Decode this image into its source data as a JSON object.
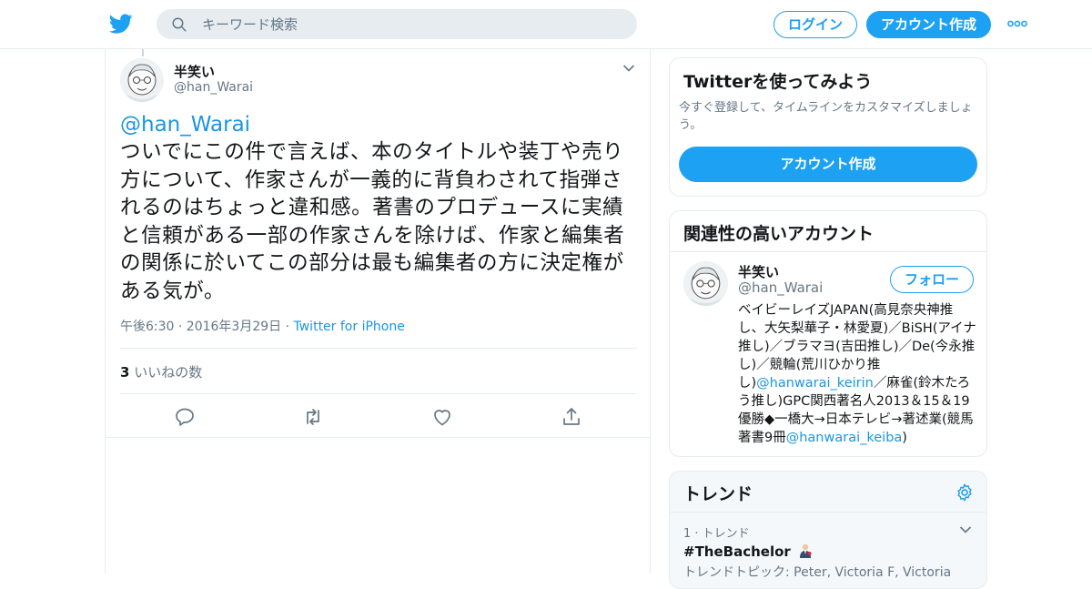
{
  "header": {
    "search_placeholder": "キーワード検索",
    "login_label": "ログイン",
    "signup_label": "アカウント作成",
    "brand_color": "#1da1f2",
    "logo_icon": "twitter-bird-icon"
  },
  "tweet": {
    "author_name": "半笑い",
    "author_handle": "@han_Warai",
    "mention": "@han_Warai",
    "text": "ついでにこの件で言えば、本のタイトルや装丁や売り方について、作家さんが一義的に背負わされて指弾されるのはちょっと違和感。著書のプロデュースに実績と信頼がある一部の作家さんを除けば、作家と編集者の関係に於いてこの部分は最も編集者の方に決定権がある気が。",
    "timestamp": "午後6:30 · 2016年3月29日 · ",
    "source": "Twitter for iPhone",
    "likes_count": "3",
    "likes_label": " いいねの数",
    "actions": [
      "reply-icon",
      "retweet-icon",
      "like-icon",
      "share-icon"
    ]
  },
  "signup_card": {
    "title": "Twitterを使ってみよう",
    "description": "今すぐ登録して、タイムラインをカスタマイズしましょう。",
    "button_label": "アカウント作成"
  },
  "related_card": {
    "title": "関連性の高いアカウント",
    "account": {
      "name": "半笑い",
      "handle": "@han_Warai",
      "follow_label": "フォロー",
      "bio_part1": "ベイビーレイズJAPAN(高見奈央神推し、大矢梨華子・林愛夏)／BiSH(アイナ推し)／ブラマヨ(吉田推し)／De(今永推し)／競輪(荒川ひかり推し)",
      "bio_link1": "@hanwarai_keirin",
      "bio_part2": "／麻雀(鈴木たろう推し)GPC関西著名人2013＆15＆19優勝◆一橋大→日本テレビ→著述業(競馬著書9冊",
      "bio_link2": "@hanwarai_keiba",
      "bio_part3": ")"
    }
  },
  "trends_card": {
    "title": "トレンド",
    "items": [
      {
        "rank_label": "1 · トレンド",
        "tag": "#TheBachelor",
        "topic": "トレンドトピック: Peter, Victoria F, Victoria"
      }
    ]
  }
}
